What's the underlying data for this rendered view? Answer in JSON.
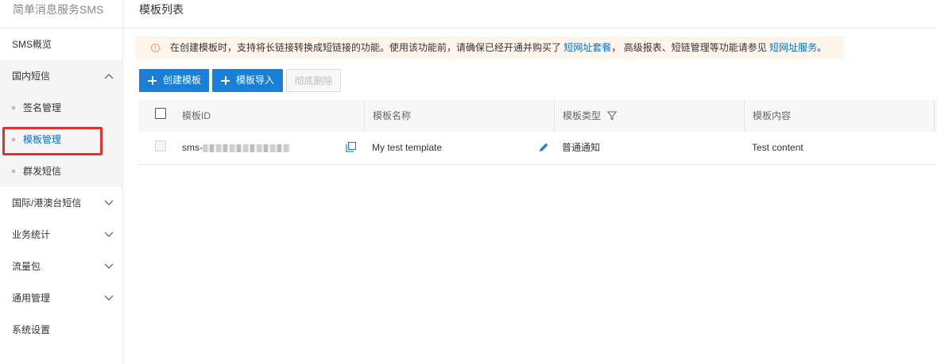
{
  "sidebar": {
    "title": "简单消息服务SMS",
    "items": [
      {
        "label": "SMS概览"
      },
      {
        "label": "国内短信",
        "expanded": true
      },
      {
        "label": "国际/港澳台短信"
      },
      {
        "label": "业务统计"
      },
      {
        "label": "流量包"
      },
      {
        "label": "通用管理"
      },
      {
        "label": "系统设置"
      }
    ],
    "sub_items": [
      {
        "label": "签名管理"
      },
      {
        "label": "模板管理",
        "active": true
      },
      {
        "label": "群发短信"
      }
    ]
  },
  "main": {
    "title": "模板列表",
    "notice": {
      "text_before": "在创建模板时，支持将长链接转换成短链接的功能。使用该功能前，请确保已经开通并购买了",
      "link1": "短网址套餐",
      "text_middle": "，  高级报表、短链管理等功能请参见",
      "link2": "短网址服务",
      "text_after": "。"
    },
    "toolbar": {
      "create_label": "创建模板",
      "import_label": "模板导入",
      "delete_label": "彻底删除"
    },
    "table": {
      "columns": [
        "模板ID",
        "模板名称",
        "模板类型",
        "模板内容"
      ],
      "rows": [
        {
          "id_prefix": "sms-",
          "name": "My test template",
          "type": "普通通知",
          "content": "Test content"
        }
      ]
    }
  },
  "colors": {
    "accent": "#1a7fd6",
    "link": "#0071ce",
    "highlight": "#e0332b",
    "notice_bg": "#fff5eb",
    "warning": "#f2a340"
  }
}
